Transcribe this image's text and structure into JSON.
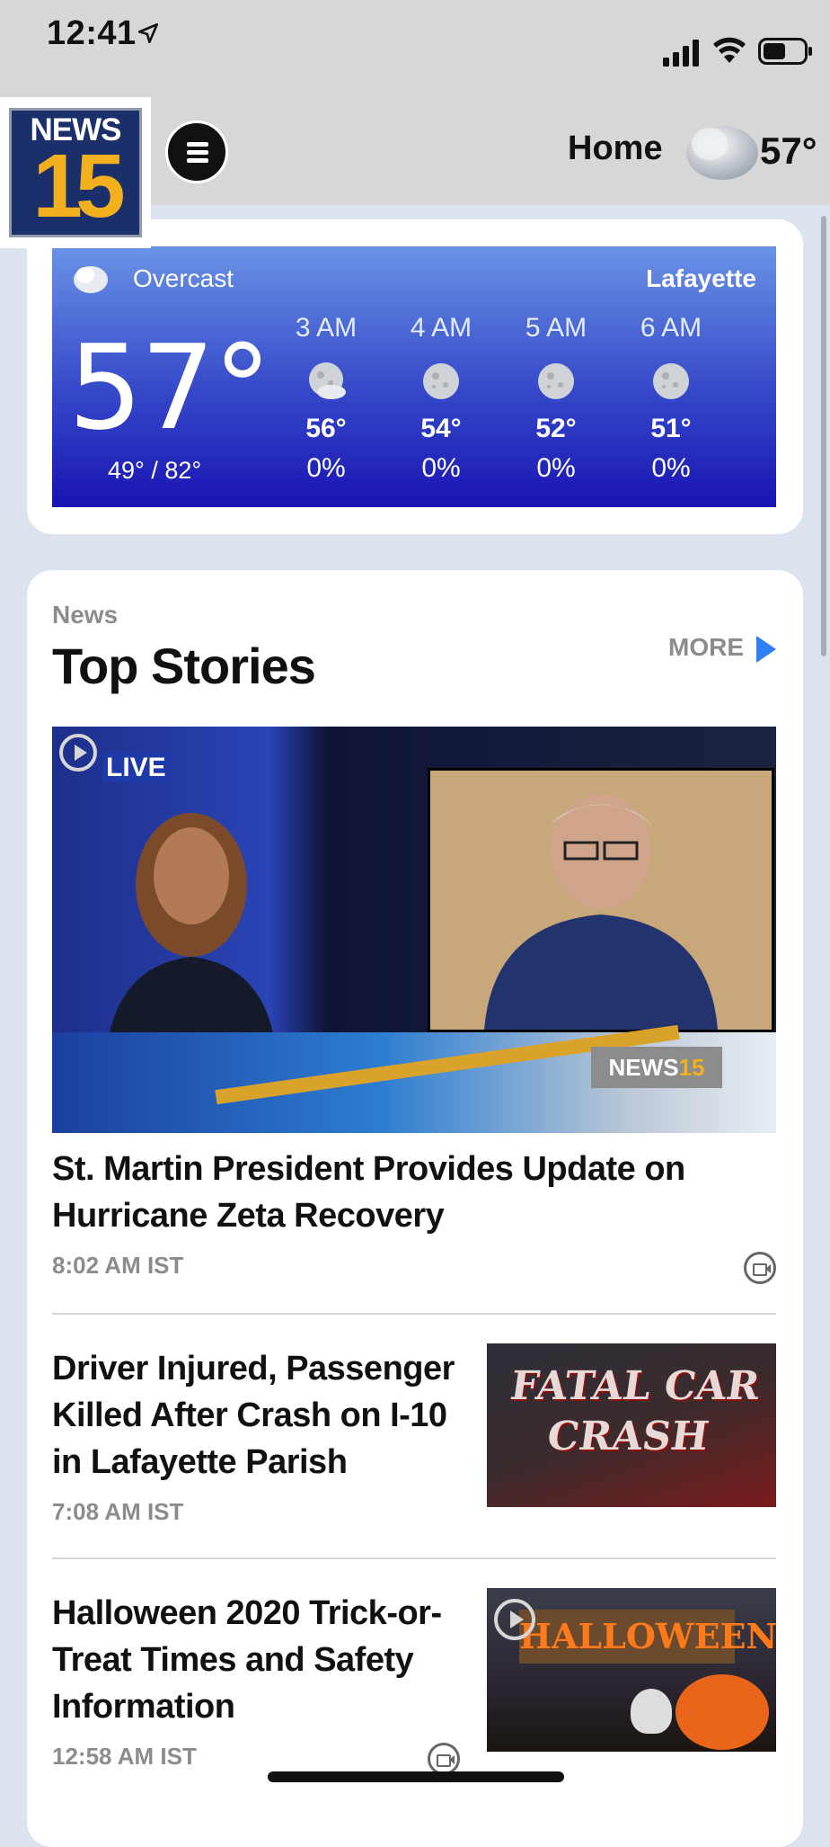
{
  "status_bar": {
    "time": "12:41"
  },
  "header": {
    "logo_top": "NEWS",
    "logo_number": "15",
    "home_label": "Home",
    "temperature": "57°"
  },
  "weather": {
    "condition": "Overcast",
    "city": "Lafayette",
    "current_temp": "57°",
    "range": "49° / 82°",
    "hourly": [
      {
        "hour": "3 AM",
        "temp": "56°",
        "precip": "0%"
      },
      {
        "hour": "4 AM",
        "temp": "54°",
        "precip": "0%"
      },
      {
        "hour": "5 AM",
        "temp": "52°",
        "precip": "0%"
      },
      {
        "hour": "6 AM",
        "temp": "51°",
        "precip": "0%"
      }
    ]
  },
  "news": {
    "section_label": "News",
    "title": "Top Stories",
    "more_label": "MORE",
    "live_label": "LIVE",
    "hero_logo_text": "NEWS",
    "hero_logo_num": "15",
    "stories": [
      {
        "headline": "St. Martin President Provides Update on Hurricane Zeta Recovery",
        "time": "8:02 AM IST"
      },
      {
        "headline": "Driver Injured, Passenger Killed After Crash on I-10 in Lafayette Parish",
        "time": "7:08 AM IST",
        "thumb_text": "FATAL CAR CRASH"
      },
      {
        "headline": "Halloween 2020 Trick-or-Treat Times and Safety Information",
        "time": "12:58 AM IST",
        "thumb_text": "HALLOWEEN"
      }
    ]
  },
  "colors": {
    "accent_blue": "#2f7ef5",
    "logo_gold": "#f2b01e",
    "weather_top": "#6a93e6",
    "weather_bottom": "#1814b2"
  }
}
